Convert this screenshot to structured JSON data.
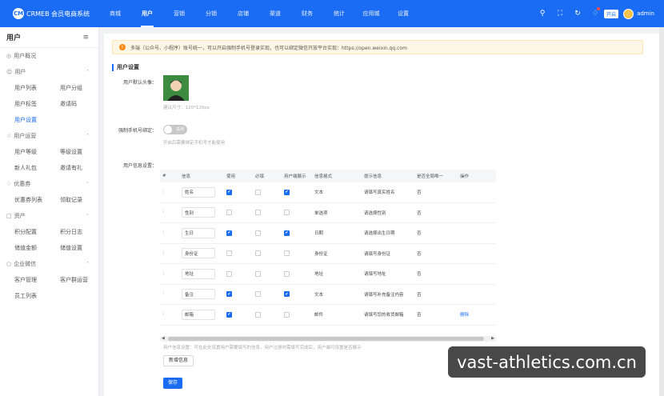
{
  "brand": {
    "logo_mark": "CM",
    "name": "CRMEB 会员电商系统"
  },
  "nav": [
    "商城",
    "用户",
    "营销",
    "分销",
    "店铺",
    "渠道",
    "财务",
    "统计",
    "应用城",
    "设置"
  ],
  "nav_active": 1,
  "topbar": {
    "badge": "开启",
    "user": "admin",
    "icons": [
      "search-icon",
      "fullscreen-icon",
      "refresh-icon",
      "bell-icon"
    ]
  },
  "sidebar": {
    "title": "用户",
    "collapse_icon": "menu-fold-icon",
    "groups": [
      {
        "label": "用户概况",
        "icon": "dashboard-icon",
        "items": []
      },
      {
        "label": "用户",
        "icon": "user-icon",
        "items": [
          "用户列表",
          "用户分组",
          "用户标签",
          "邀请码",
          "用户设置"
        ]
      },
      {
        "label": "用户运营",
        "icon": "ops-icon",
        "items": [
          "用户等级",
          "等级设置",
          "新人礼包",
          "邀请有礼"
        ]
      },
      {
        "label": "优惠券",
        "icon": "coupon-icon",
        "items": [
          "优惠券列表",
          "领取记录"
        ]
      },
      {
        "label": "资产",
        "icon": "asset-icon",
        "items": [
          "积分配置",
          "积分日志",
          "储值金额",
          "储值设置"
        ]
      },
      {
        "label": "企业微信",
        "icon": "wechat-icon",
        "items": [
          "客户管理",
          "客户群运营",
          "员工列表"
        ]
      }
    ],
    "active_item": "用户设置"
  },
  "notice": "多端（公众号、小程序）账号统一，可以开启强制手机号登录实现，也可以绑定微信开放平台实现：https://open.weixin.qq.com",
  "section_title": "用户设置",
  "form": {
    "avatar_label": "用户默认头像：",
    "avatar_hint": "建议尺寸：120*120px",
    "phone_label": "强制手机号绑定：",
    "phone_switch": "关闭",
    "phone_hint": "开启后需要绑定手机号才能使用",
    "info_label": "用户信息设置："
  },
  "table": {
    "headers": [
      "#",
      "信息",
      "使用",
      "必填",
      "用户端展示",
      "信息格式",
      "提示信息",
      "是否全局唯一",
      "操作"
    ],
    "rows": [
      {
        "name": "姓名",
        "use": true,
        "req": false,
        "show": true,
        "fmt": "文本",
        "tip": "请填写真实姓名",
        "unique": "否",
        "op": ""
      },
      {
        "name": "性别",
        "use": false,
        "req": false,
        "show": false,
        "fmt": "单选项",
        "tip": "请选择性别",
        "unique": "否",
        "op": ""
      },
      {
        "name": "生日",
        "use": true,
        "req": false,
        "show": true,
        "fmt": "日期",
        "tip": "请选择出生日期",
        "unique": "否",
        "op": ""
      },
      {
        "name": "身份证",
        "use": false,
        "req": false,
        "show": false,
        "fmt": "身份证",
        "tip": "请填写身份证",
        "unique": "否",
        "op": ""
      },
      {
        "name": "地址",
        "use": false,
        "req": false,
        "show": false,
        "fmt": "地址",
        "tip": "请填写地址",
        "unique": "否",
        "op": ""
      },
      {
        "name": "备注",
        "use": true,
        "req": false,
        "show": true,
        "fmt": "文本",
        "tip": "请填写补充备注内容",
        "unique": "否",
        "op": ""
      },
      {
        "name": "邮箱",
        "use": true,
        "req": false,
        "show": false,
        "fmt": "邮件",
        "tip": "请填写您的收货邮箱",
        "unique": "否",
        "op": "删除"
      }
    ],
    "footer_hint": "用户信息设置：可在此处设置用户需要填写的信息，用户注册时需填写完成后，用户端可设置是否展示"
  },
  "buttons": {
    "add": "新增信息",
    "save": "保存"
  },
  "watermark": "vast-athletics.com.cn"
}
